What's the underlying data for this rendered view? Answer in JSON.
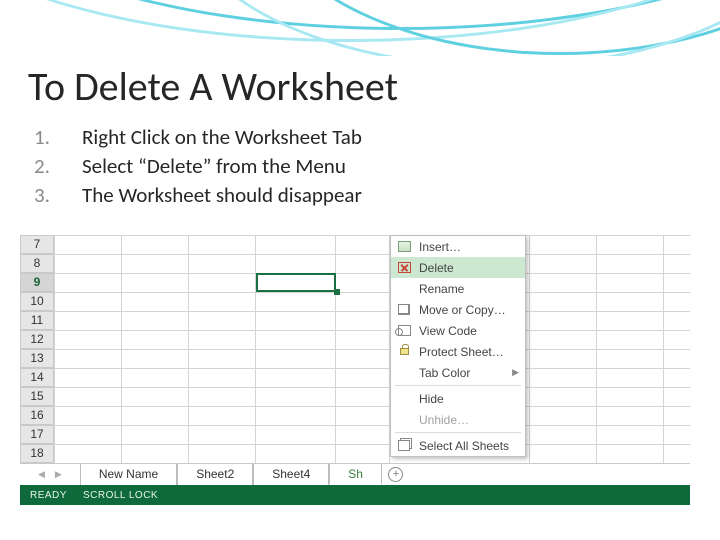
{
  "title": "To Delete A Worksheet",
  "steps": [
    {
      "num": "1.",
      "text": "Right Click on the Worksheet Tab"
    },
    {
      "num": "2.",
      "text": "Select “Delete” from the Menu"
    },
    {
      "num": "3.",
      "text": "The Worksheet should disappear"
    }
  ],
  "excel": {
    "row_headers": [
      "7",
      "8",
      "9",
      "10",
      "11",
      "12",
      "13",
      "14",
      "15",
      "16",
      "17",
      "18"
    ],
    "active_row_index": 2,
    "context_menu": {
      "insert": "Insert…",
      "delete": "Delete",
      "rename": "Rename",
      "move": "Move or Copy…",
      "code": "View Code",
      "protect": "Protect Sheet…",
      "color": "Tab Color",
      "hide": "Hide",
      "unhide": "Unhide…",
      "select_all": "Select All Sheets"
    },
    "sheet_tabs": [
      "New Name",
      "Sheet2",
      "Sheet4",
      "Sh"
    ],
    "status": {
      "ready": "READY",
      "scroll": "SCROLL LOCK"
    }
  }
}
